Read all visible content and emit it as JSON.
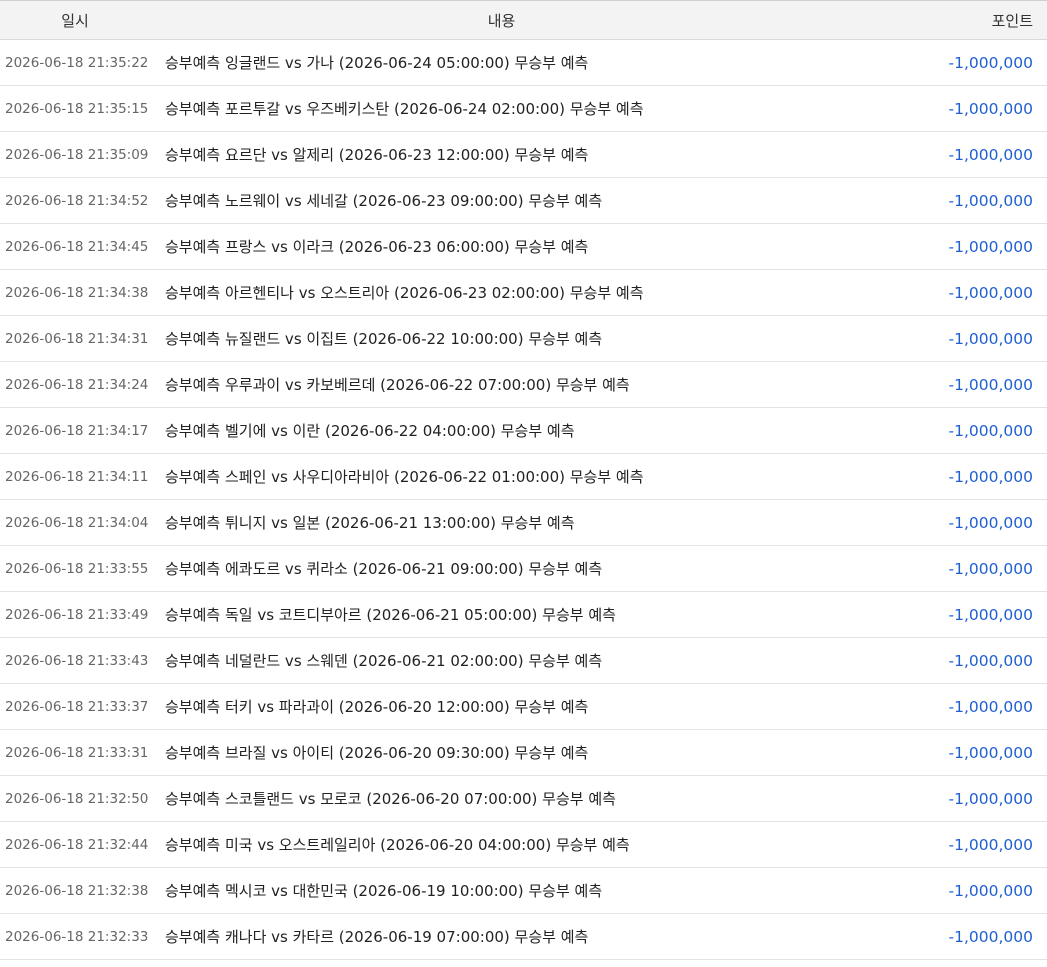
{
  "table": {
    "headers": {
      "date": "일시",
      "content": "내용",
      "points": "포인트"
    },
    "colors": {
      "points": "#1f5fd1",
      "header_bg": "#f3f3f3"
    },
    "rows": [
      {
        "date": "2026-06-18 21:35:22",
        "content": "승부예측 잉글랜드 vs 가나 (2026-06-24 05:00:00) 무승부 예측",
        "points": "-1,000,000"
      },
      {
        "date": "2026-06-18 21:35:15",
        "content": "승부예측 포르투갈 vs 우즈베키스탄 (2026-06-24 02:00:00) 무승부 예측",
        "points": "-1,000,000"
      },
      {
        "date": "2026-06-18 21:35:09",
        "content": "승부예측 요르단 vs 알제리 (2026-06-23 12:00:00) 무승부 예측",
        "points": "-1,000,000"
      },
      {
        "date": "2026-06-18 21:34:52",
        "content": "승부예측 노르웨이 vs 세네갈 (2026-06-23 09:00:00) 무승부 예측",
        "points": "-1,000,000"
      },
      {
        "date": "2026-06-18 21:34:45",
        "content": "승부예측 프랑스 vs 이라크 (2026-06-23 06:00:00) 무승부 예측",
        "points": "-1,000,000"
      },
      {
        "date": "2026-06-18 21:34:38",
        "content": "승부예측 아르헨티나 vs 오스트리아 (2026-06-23 02:00:00) 무승부 예측",
        "points": "-1,000,000"
      },
      {
        "date": "2026-06-18 21:34:31",
        "content": "승부예측 뉴질랜드 vs 이집트 (2026-06-22 10:00:00) 무승부 예측",
        "points": "-1,000,000"
      },
      {
        "date": "2026-06-18 21:34:24",
        "content": "승부예측 우루과이 vs 카보베르데 (2026-06-22 07:00:00) 무승부 예측",
        "points": "-1,000,000"
      },
      {
        "date": "2026-06-18 21:34:17",
        "content": "승부예측 벨기에 vs 이란 (2026-06-22 04:00:00) 무승부 예측",
        "points": "-1,000,000"
      },
      {
        "date": "2026-06-18 21:34:11",
        "content": "승부예측 스페인 vs 사우디아라비아 (2026-06-22 01:00:00) 무승부 예측",
        "points": "-1,000,000"
      },
      {
        "date": "2026-06-18 21:34:04",
        "content": "승부예측 튀니지 vs 일본 (2026-06-21 13:00:00) 무승부 예측",
        "points": "-1,000,000"
      },
      {
        "date": "2026-06-18 21:33:55",
        "content": "승부예측 에콰도르 vs 퀴라소 (2026-06-21 09:00:00) 무승부 예측",
        "points": "-1,000,000"
      },
      {
        "date": "2026-06-18 21:33:49",
        "content": "승부예측 독일 vs 코트디부아르 (2026-06-21 05:00:00) 무승부 예측",
        "points": "-1,000,000"
      },
      {
        "date": "2026-06-18 21:33:43",
        "content": "승부예측 네덜란드 vs 스웨덴 (2026-06-21 02:00:00) 무승부 예측",
        "points": "-1,000,000"
      },
      {
        "date": "2026-06-18 21:33:37",
        "content": "승부예측 터키 vs 파라과이 (2026-06-20 12:00:00) 무승부 예측",
        "points": "-1,000,000"
      },
      {
        "date": "2026-06-18 21:33:31",
        "content": "승부예측 브라질 vs 아이티 (2026-06-20 09:30:00) 무승부 예측",
        "points": "-1,000,000"
      },
      {
        "date": "2026-06-18 21:32:50",
        "content": "승부예측 스코틀랜드 vs 모로코 (2026-06-20 07:00:00) 무승부 예측",
        "points": "-1,000,000"
      },
      {
        "date": "2026-06-18 21:32:44",
        "content": "승부예측 미국 vs 오스트레일리아 (2026-06-20 04:00:00) 무승부 예측",
        "points": "-1,000,000"
      },
      {
        "date": "2026-06-18 21:32:38",
        "content": "승부예측 멕시코 vs 대한민국 (2026-06-19 10:00:00) 무승부 예측",
        "points": "-1,000,000"
      },
      {
        "date": "2026-06-18 21:32:33",
        "content": "승부예측 캐나다 vs 카타르 (2026-06-19 07:00:00) 무승부 예측",
        "points": "-1,000,000"
      }
    ]
  }
}
